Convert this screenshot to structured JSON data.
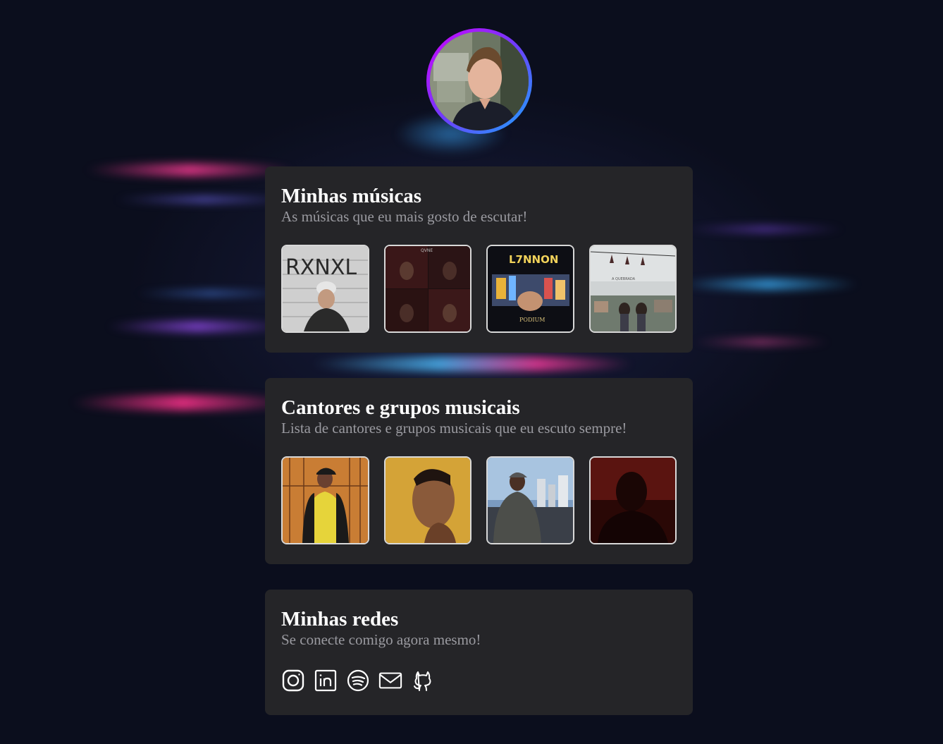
{
  "profile": {
    "avatar_icon": "profile-photo"
  },
  "sections": {
    "music": {
      "title": "Minhas músicas",
      "subtitle": "As músicas que eu mais gosto de escutar!",
      "covers": [
        {
          "label": "RXNXL"
        },
        {
          "label": "QVNE"
        },
        {
          "label": "L7NNON",
          "sub": "PODIUM"
        },
        {
          "label": "A QUEBRADA"
        }
      ]
    },
    "artists": {
      "title": "Cantores e grupos musicais",
      "subtitle": "Lista de cantores e grupos musicais que eu escuto sempre!"
    },
    "socials": {
      "title": "Minhas redes",
      "subtitle": "Se conecte comigo agora mesmo!",
      "icons": [
        "instagram-icon",
        "linkedin-icon",
        "spotify-icon",
        "mail-icon",
        "github-icon"
      ]
    }
  },
  "colors": {
    "background": "#0b0e1d",
    "card": "#252528",
    "gradient_start": "#d100ff",
    "gradient_end": "#1ab6ff",
    "subtitle": "#9a9aa0"
  }
}
